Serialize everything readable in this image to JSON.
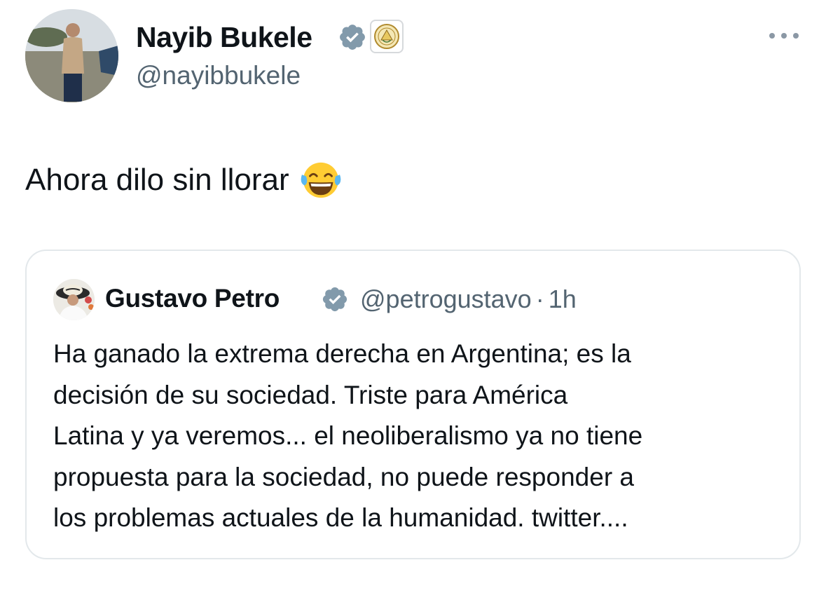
{
  "tweet": {
    "author": {
      "name": "Nayib Bukele",
      "handle": "@nayibbukele",
      "verified_icon": "verified-badge-icon",
      "affiliate_icon": "el-salvador-coat-of-arms-icon"
    },
    "more_icon": "more-options-icon",
    "text": "Ahora dilo sin llorar",
    "emoji": "face-with-tears-of-joy-icon",
    "quoted": {
      "author_name": "Gustavo Petro",
      "handle": "@petrogustavo",
      "separator": "·",
      "time": "1h",
      "text_lines": [
        "Ha ganado la extrema derecha en Argentina; es la",
        "decisión de su sociedad. Triste para América",
        "Latina y ya veremos... el neoliberalismo ya no tiene",
        "propuesta para la sociedad, no puede responder a",
        "los problemas actuales de la humanidad. twitter...."
      ]
    }
  },
  "colors": {
    "primary_text": "#0f1419",
    "secondary_text": "#536471",
    "verified_badge": "#829aab",
    "border": "#e3e8eb"
  }
}
